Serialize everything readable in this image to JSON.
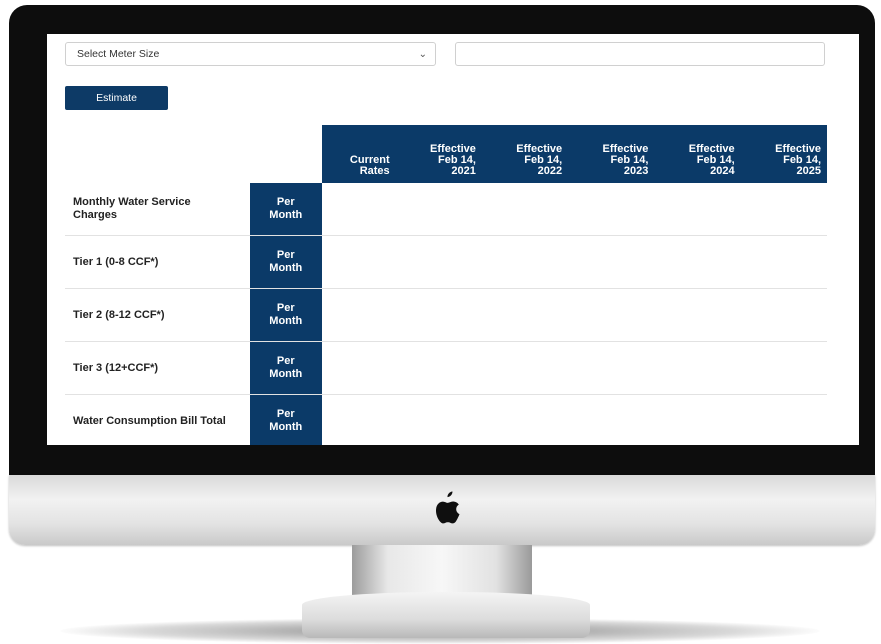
{
  "controls": {
    "meter_select_value": "Select Meter Size",
    "estimate_label": "Estimate"
  },
  "table": {
    "columns": [
      [
        "Current",
        "Rates"
      ],
      [
        "Effective",
        "Feb 14,",
        "2021"
      ],
      [
        "Effective",
        "Feb 14,",
        "2022"
      ],
      [
        "Effective",
        "Feb 14,",
        "2023"
      ],
      [
        "Effective",
        "Feb 14,",
        "2024"
      ],
      [
        "Effective",
        "Feb 14,",
        "2025"
      ]
    ],
    "rows": [
      {
        "label": [
          "Monthly Water Service",
          "Charges"
        ],
        "unit": [
          "Per",
          "Month"
        ]
      },
      {
        "label": [
          "Tier 1 (0-8 CCF*)"
        ],
        "unit": [
          "Per",
          "Month"
        ]
      },
      {
        "label": [
          "Tier 2 (8-12 CCF*)"
        ],
        "unit": [
          "Per",
          "Month"
        ]
      },
      {
        "label": [
          "Tier 3 (12+CCF*)"
        ],
        "unit": [
          "Per",
          "Month"
        ]
      },
      {
        "label": [
          "Water Consumption Bill Total"
        ],
        "unit": [
          "Per",
          "Month"
        ]
      }
    ]
  },
  "icons": {
    "logo": "apple-logo-icon",
    "select": "chevron-down-icon"
  }
}
